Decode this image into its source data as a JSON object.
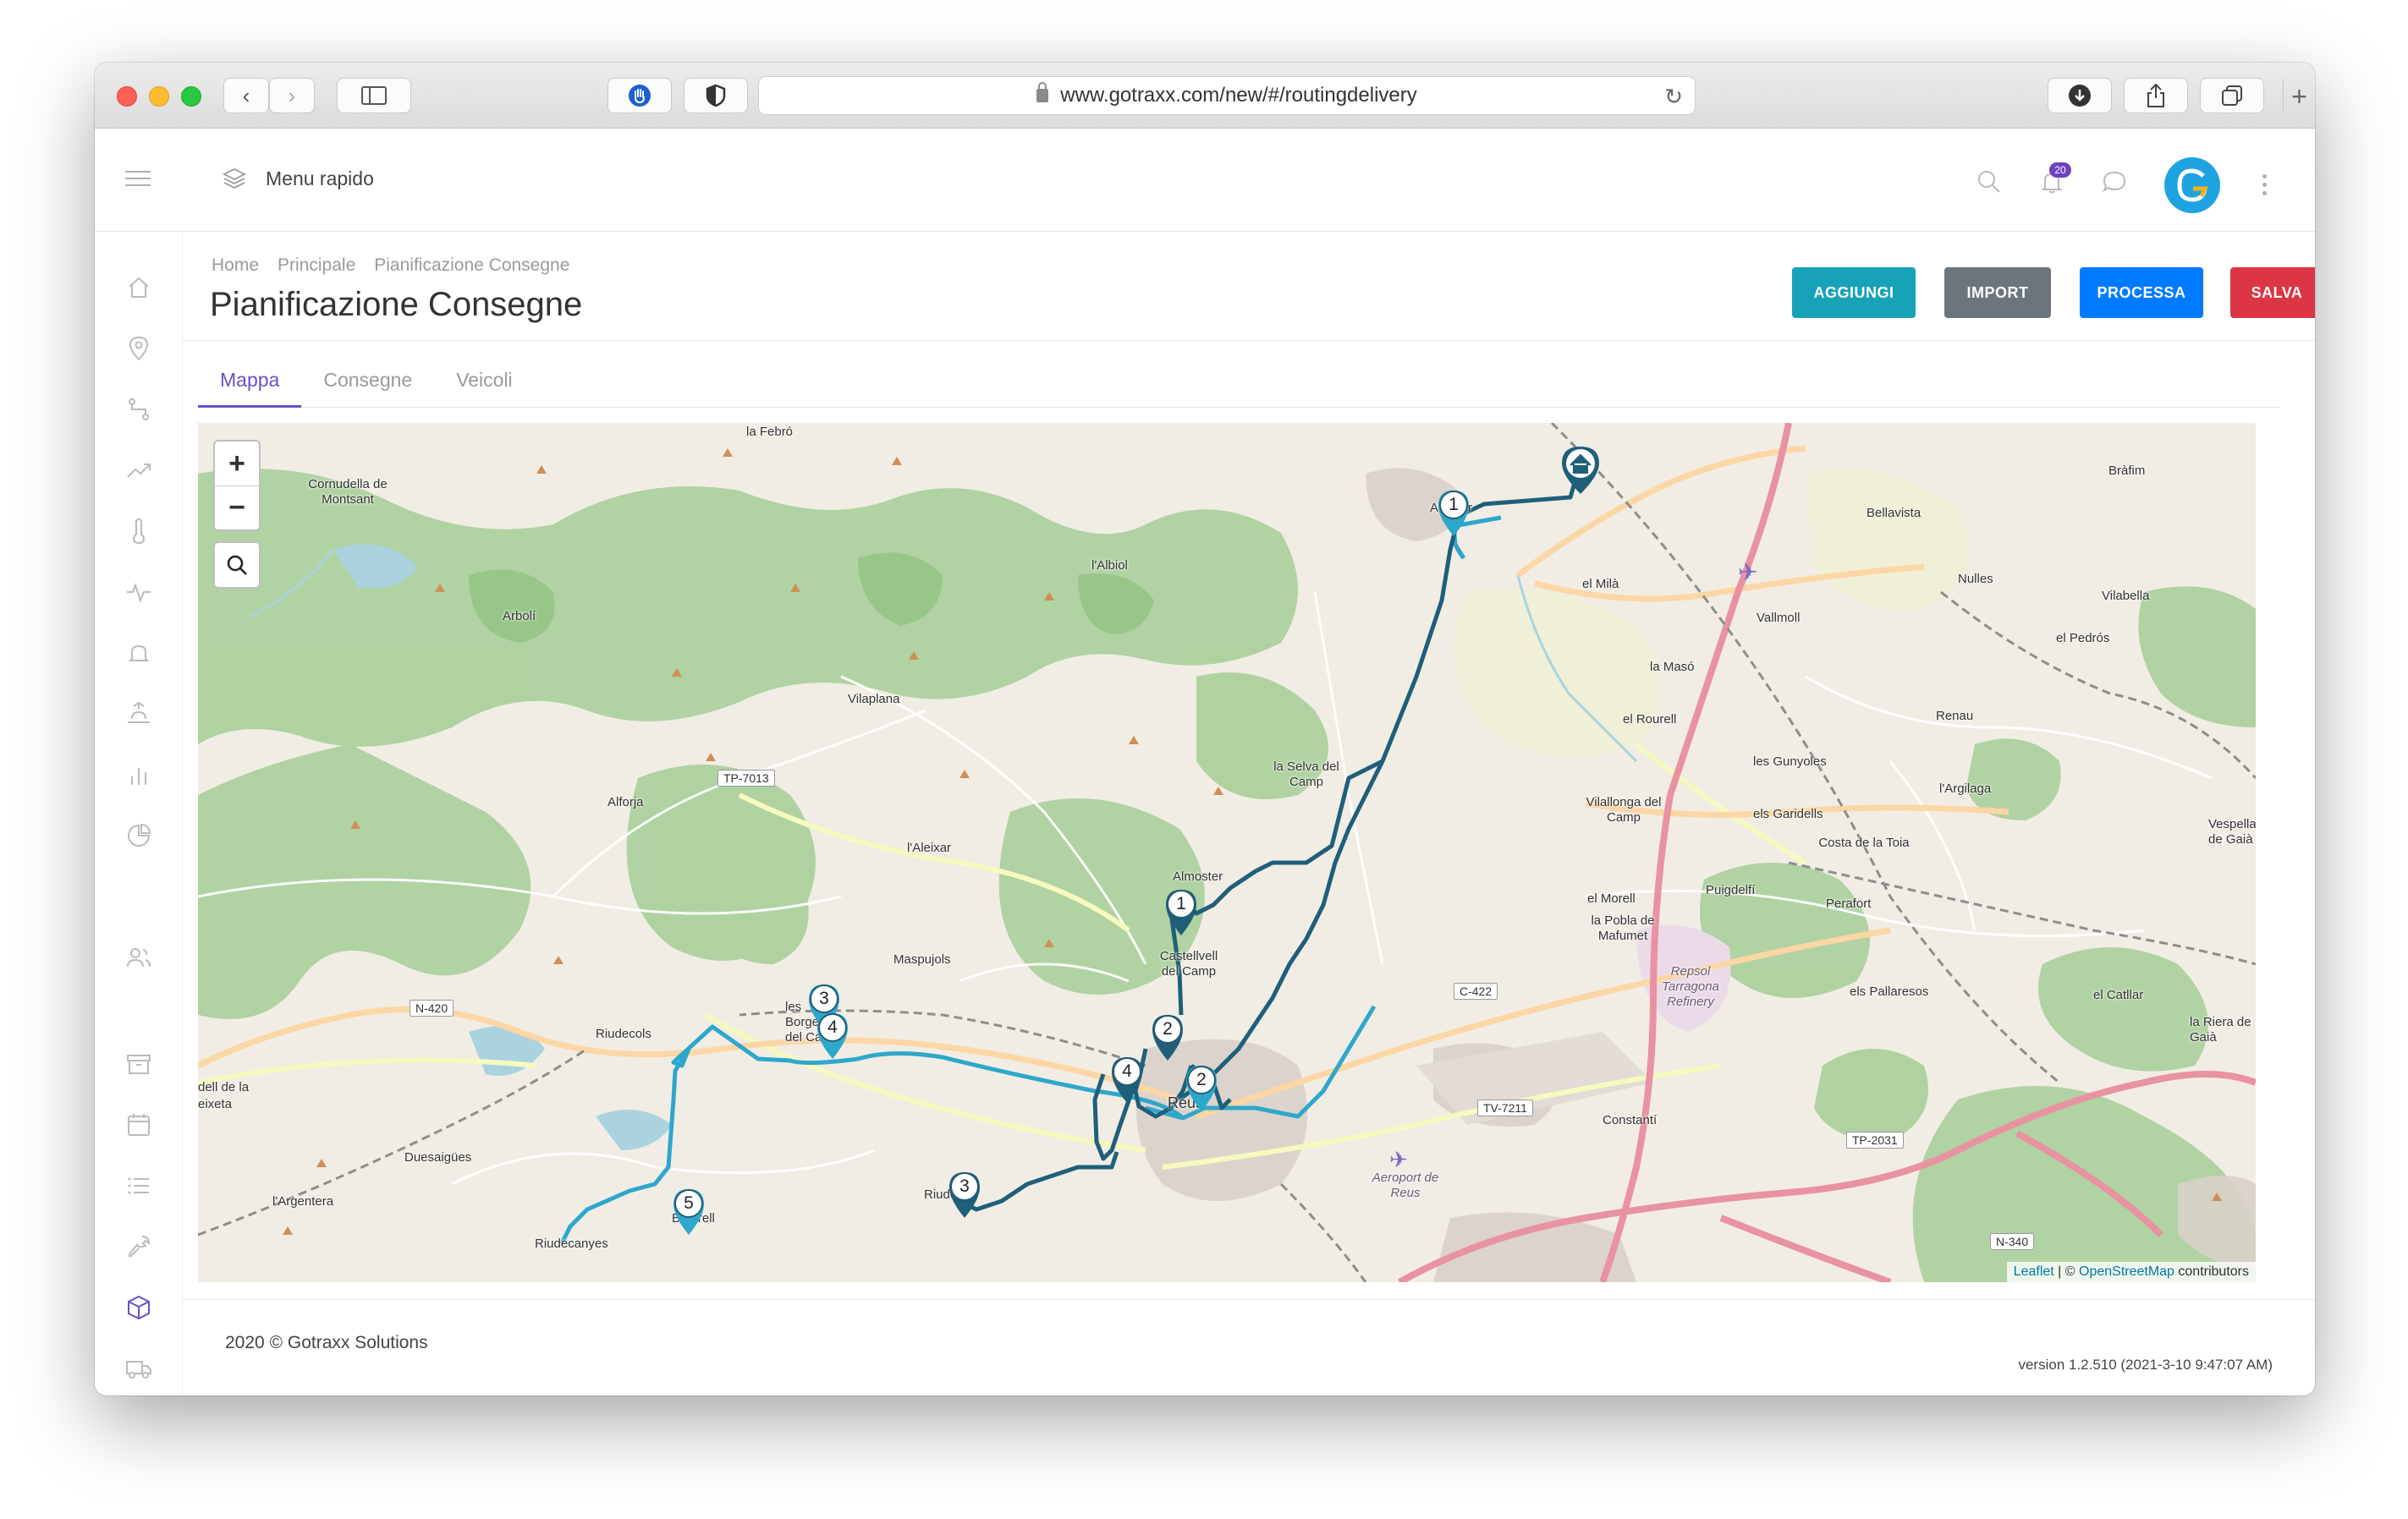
{
  "browser": {
    "url": "www.gotraxx.com/new/#/routingdelivery"
  },
  "header": {
    "menu_label": "Menu rapido",
    "notification_count": "20"
  },
  "breadcrumb": [
    "Home",
    "Principale",
    "Pianificazione Consegne"
  ],
  "page": {
    "title": "Pianificazione Consegne"
  },
  "actions": {
    "aggiungi": "AGGIUNGI",
    "import": "IMPORT",
    "processa": "PROCESSA",
    "salva": "SALVA"
  },
  "colors": {
    "aggiungi": "#17a2b8",
    "import": "#6c757d",
    "processa": "#007bff",
    "salva": "#dc3545",
    "accent": "#6a4fc6",
    "route_dark": "#1f5f7a",
    "route_light": "#2ea7cc"
  },
  "tabs": [
    {
      "label": "Mappa",
      "active": true
    },
    {
      "label": "Consegne",
      "active": false
    },
    {
      "label": "Veicoli",
      "active": false
    }
  ],
  "map": {
    "zoom_in": "+",
    "zoom_out": "−",
    "attribution_leaflet": "Leaflet",
    "attribution_sep": " | © ",
    "attribution_osm": "OpenStreetMap",
    "attribution_tail": " contributors",
    "places": [
      "la Febró",
      "Cornudella de Montsant",
      "Arbolí",
      "l'Albiol",
      "Vilaplana",
      "Alforja",
      "la Selva del Camp",
      "l'Aleixar",
      "Almoster",
      "Maspujols",
      "Castellvell del Camp",
      "Riudecols",
      "les Borges del Camp",
      "dell de la eixeta",
      "Duesaigües",
      "l'Argentera",
      "Riudecanyes",
      "Botarell",
      "Riudoms",
      "Reus",
      "el Milà",
      "Vallmoll",
      "la Masó",
      "el Rourell",
      "Vilallonga del Camp",
      "les Gunyoles",
      "els Garidells",
      "l'Argilaga",
      "Costa de la Toia",
      "Puigdelfí",
      "Perafort",
      "el Morell",
      "la Pobla de Mafumet",
      "Repsol Tarragona Refinery",
      "els Pallaresos",
      "el Catllar",
      "la Riera de Gaià",
      "Constantí",
      "Aeroport de Reus",
      "Bràfim",
      "Bellavista",
      "Nulles",
      "Vilabella",
      "el Pedrós",
      "Renau",
      "Vespella de Gaià",
      "Alcover"
    ],
    "roads": [
      "TP-7013",
      "N-420",
      "C-422",
      "TV-7211",
      "TP-2031",
      "N-340"
    ],
    "markers": [
      {
        "label": "1",
        "type": "light"
      },
      {
        "label": "1",
        "type": "dark"
      },
      {
        "label": "2",
        "type": "dark"
      },
      {
        "label": "2",
        "type": "light"
      },
      {
        "label": "3",
        "type": "light"
      },
      {
        "label": "4",
        "type": "light"
      },
      {
        "label": "4",
        "type": "dark"
      },
      {
        "label": "3",
        "type": "dark"
      },
      {
        "label": "5",
        "type": "light"
      }
    ],
    "depot_icon": "home-icon"
  },
  "footer": {
    "copyright": "2020 © Gotraxx Solutions",
    "version": "version 1.2.510 (2021-3-10 9:47:07 AM)"
  }
}
